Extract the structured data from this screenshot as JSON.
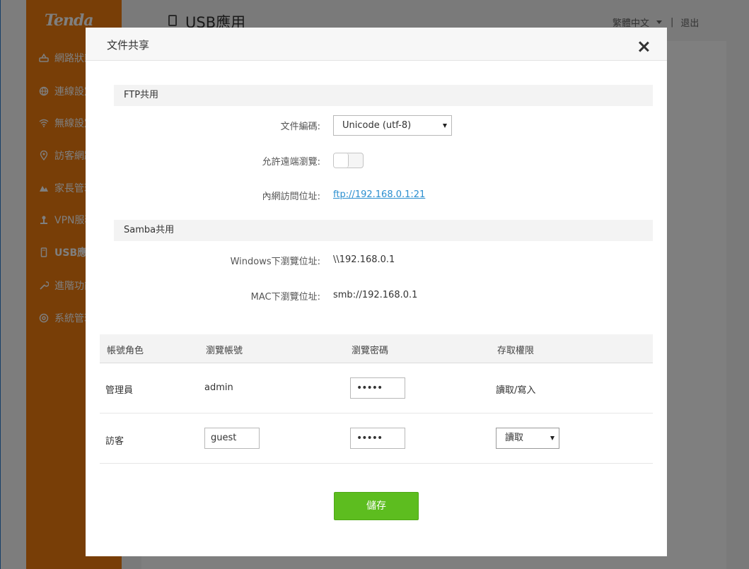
{
  "app": {
    "brand": "Tenda",
    "page_title": "USB應用",
    "language": "繁體中文",
    "separator": "|",
    "logout": "退出",
    "brand_color": "#f07c0f"
  },
  "sidebar": {
    "items": [
      {
        "label": "網路狀態",
        "icon": "network-status-icon"
      },
      {
        "label": "連線設定",
        "icon": "globe-icon"
      },
      {
        "label": "無線設定",
        "icon": "wifi-icon"
      },
      {
        "label": "訪客網路",
        "icon": "location-icon"
      },
      {
        "label": "家長管理",
        "icon": "parental-control-icon"
      },
      {
        "label": "VPN服務",
        "icon": "vpn-icon"
      },
      {
        "label": "USB應用",
        "icon": "usb-icon",
        "active": true
      },
      {
        "label": "進階功能",
        "icon": "wrench-icon"
      },
      {
        "label": "系統管理",
        "icon": "gear-icon"
      }
    ]
  },
  "modal": {
    "title": "文件共享",
    "close_icon": "close-icon",
    "ftp": {
      "section_title": "FTP共用",
      "encoding_label": "文件編碼:",
      "encoding_value": "Unicode (utf-8)",
      "remote_label": "允許遠端瀏覽:",
      "remote_enabled": false,
      "lan_label": "內網訪問位址:",
      "lan_value": "ftp://192.168.0.1:21"
    },
    "samba": {
      "section_title": "Samba共用",
      "windows_label": "Windows下瀏覽位址:",
      "windows_value": "\\\\192.168.0.1",
      "mac_label": "MAC下瀏覽位址:",
      "mac_value": "smb://192.168.0.1"
    },
    "table": {
      "headers": [
        "帳號角色",
        "瀏覽帳號",
        "瀏覽密碼",
        "存取權限"
      ],
      "rows": [
        {
          "role": "管理員",
          "account": "admin",
          "password": "•••••",
          "permission": "讀取/寫入"
        },
        {
          "role": "訪客",
          "account": "guest",
          "password": "•••••",
          "permission": "讀取"
        }
      ]
    },
    "save_label": "儲存",
    "save_color": "#5dbd1f"
  }
}
